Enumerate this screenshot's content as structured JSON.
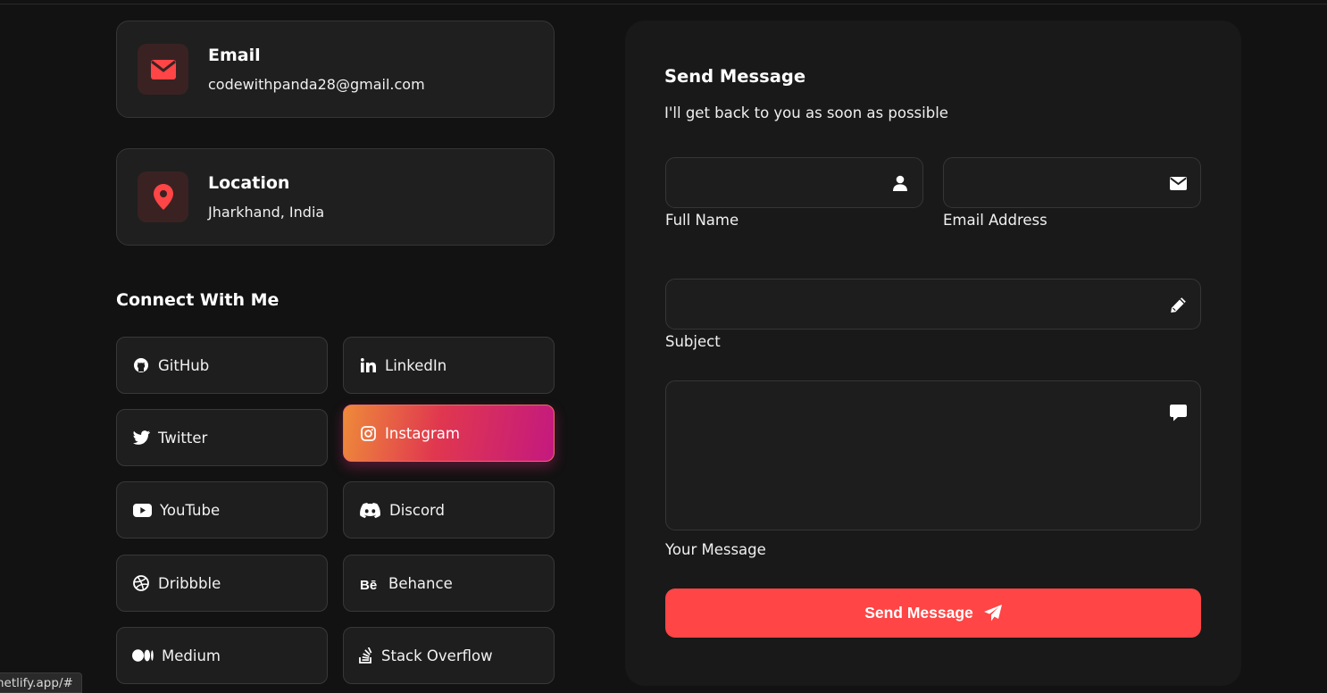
{
  "contact_info": {
    "email": {
      "title": "Email",
      "value": "codewithpanda28@gmail.com",
      "icon": "envelope-icon"
    },
    "location": {
      "title": "Location",
      "value": "Jharkhand, India",
      "icon": "map-pin-icon"
    }
  },
  "connect": {
    "title": "Connect With Me",
    "items": [
      {
        "label": "GitHub",
        "icon": "github-icon"
      },
      {
        "label": "LinkedIn",
        "icon": "linkedin-icon"
      },
      {
        "label": "Twitter",
        "icon": "twitter-icon"
      },
      {
        "label": "Instagram",
        "icon": "instagram-icon",
        "state": "hover"
      },
      {
        "label": "YouTube",
        "icon": "youtube-icon"
      },
      {
        "label": "Discord",
        "icon": "discord-icon"
      },
      {
        "label": "Dribbble",
        "icon": "dribbble-icon"
      },
      {
        "label": "Behance",
        "icon": "behance-icon"
      },
      {
        "label": "Medium",
        "icon": "medium-icon"
      },
      {
        "label": "Stack Overflow",
        "icon": "stack-overflow-icon"
      }
    ]
  },
  "form": {
    "title": "Send Message",
    "subtitle": "I'll get back to you as soon as possible",
    "fields": {
      "full_name": {
        "label": "Full Name",
        "value": "",
        "icon": "user-icon"
      },
      "email": {
        "label": "Email Address",
        "value": "",
        "icon": "envelope-icon"
      },
      "subject": {
        "label": "Subject",
        "value": "",
        "icon": "pencil-icon"
      },
      "message": {
        "label": "Your Message",
        "value": "",
        "icon": "comment-icon"
      }
    },
    "submit_label": "Send Message",
    "submit_icon": "paper-plane-icon"
  },
  "status_bar": {
    "url": "netlify.app/#"
  },
  "colors": {
    "accent": "#ff4545",
    "background": "#121212",
    "card": "#1f1f1f",
    "icon_bg": "#3a2223",
    "instagram_gradient": [
      "#ee8a3a",
      "#e0374f",
      "#c4197f"
    ]
  }
}
